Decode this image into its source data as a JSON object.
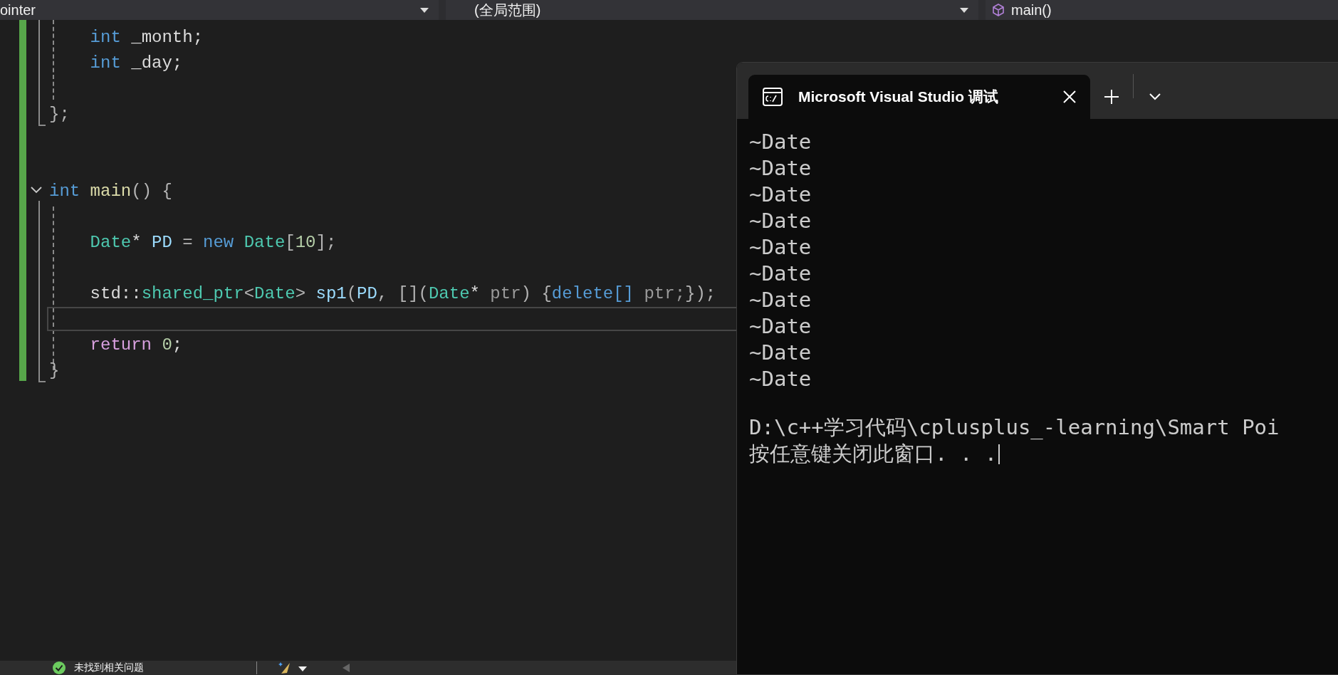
{
  "navigation_bar": {
    "dropdowns": [
      {
        "label": "ointer",
        "kind": "plain"
      },
      {
        "label": "(全局范围)",
        "kind": "plain"
      },
      {
        "label": "main()",
        "kind": "member"
      }
    ]
  },
  "editor": {
    "lines": [
      {
        "kind": "code",
        "tokens": [
          {
            "t": "    int",
            "color": "#569cd6"
          },
          {
            "t": " _month;",
            "color": "#dcdcdc"
          }
        ]
      },
      {
        "kind": "code",
        "tokens": [
          {
            "t": "    int",
            "color": "#569cd6"
          },
          {
            "t": " _day;",
            "color": "#dcdcdc"
          }
        ]
      },
      {
        "kind": "blank"
      },
      {
        "kind": "code",
        "tokens": [
          {
            "t": "};",
            "color": "#b4b4b4"
          }
        ]
      },
      {
        "kind": "blank"
      },
      {
        "kind": "blank"
      },
      {
        "kind": "code",
        "expanded": true,
        "tokens": [
          {
            "t": "int",
            "color": "#569cd6"
          },
          {
            "t": " main",
            "color": "#dcdcaa"
          },
          {
            "t": "() {",
            "color": "#b4b4b4"
          }
        ]
      },
      {
        "kind": "blank"
      },
      {
        "kind": "code",
        "tokens": [
          {
            "t": "    Date",
            "color": "#4ec9b0"
          },
          {
            "t": "* ",
            "color": "#dcdcdc"
          },
          {
            "t": "PD",
            "color": "#9cdcfe"
          },
          {
            "t": " = ",
            "color": "#b4b4b4"
          },
          {
            "t": "new",
            "color": "#569cd6"
          },
          {
            "t": " Date",
            "color": "#4ec9b0"
          },
          {
            "t": "[",
            "color": "#b4b4b4"
          },
          {
            "t": "10",
            "color": "#b5cea8"
          },
          {
            "t": "];",
            "color": "#b4b4b4"
          }
        ]
      },
      {
        "kind": "blank"
      },
      {
        "kind": "code",
        "tokens": [
          {
            "t": "    std::",
            "color": "#dcdcdc"
          },
          {
            "t": "shared_ptr",
            "color": "#4ec9b0"
          },
          {
            "t": "<",
            "color": "#b4b4b4"
          },
          {
            "t": "Date",
            "color": "#4ec9b0"
          },
          {
            "t": "> ",
            "color": "#b4b4b4"
          },
          {
            "t": "sp1",
            "color": "#9cdcfe"
          },
          {
            "t": "(",
            "color": "#b4b4b4"
          },
          {
            "t": "PD",
            "color": "#9cdcfe"
          },
          {
            "t": ", [](",
            "color": "#b4b4b4"
          },
          {
            "t": "Date",
            "color": "#4ec9b0"
          },
          {
            "t": "* ",
            "color": "#dcdcdc"
          },
          {
            "t": "ptr",
            "color": "#9a9a9a"
          },
          {
            "t": ") {",
            "color": "#b4b4b4"
          },
          {
            "t": "delete[]",
            "color": "#569cd6"
          },
          {
            "t": " ptr;",
            "color": "#9a9a9a"
          },
          {
            "t": "});",
            "color": "#b4b4b4"
          }
        ]
      },
      {
        "kind": "blank",
        "current": true
      },
      {
        "kind": "code",
        "tokens": [
          {
            "t": "    return",
            "color": "#d8a0df"
          },
          {
            "t": " 0",
            "color": "#b5cea8"
          },
          {
            "t": ";",
            "color": "#dcdcdc"
          }
        ]
      },
      {
        "kind": "code",
        "tokens": [
          {
            "t": "}",
            "color": "#b4b4b4"
          }
        ]
      }
    ]
  },
  "terminal": {
    "tab": {
      "title": "Microsoft Visual Studio 调试",
      "selected": true
    },
    "output": [
      "~Date",
      "~Date",
      "~Date",
      "~Date",
      "~Date",
      "~Date",
      "~Date",
      "~Date",
      "~Date",
      "~Date"
    ],
    "path_line": "D:\\c++学习代码\\cplusplus_-learning\\Smart Poi",
    "prompt_line": "按任意键关闭此窗口. . .",
    "cursor_visible": true
  },
  "status_bar": {
    "issues": {
      "text": "未找到相关问题",
      "ok": true
    }
  }
}
